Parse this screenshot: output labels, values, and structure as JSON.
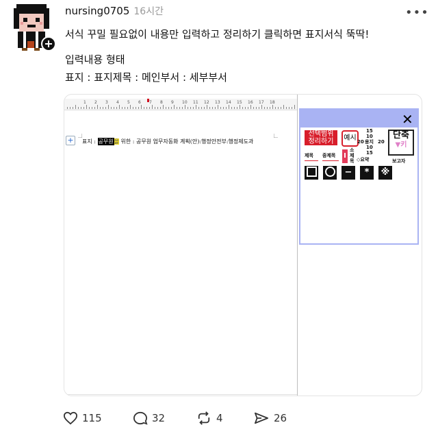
{
  "post": {
    "username": "nursing0705",
    "time": "16시간",
    "more_icon": "ellipsis-icon",
    "text_lines": [
      "서식 꾸밀 필요없이 내용만 입력하고 정리하기 클릭하면 표지서식 뚝딱!",
      "입력내용 형태",
      "표지 : 표지제목 : 메인부서 : 세부부서"
    ]
  },
  "document": {
    "line_prefix": "표지 : ",
    "selected_text": "공무원",
    "highlighted_text": "을",
    "line_rest": "위한 : 공무원 업무자동화 계획(안):행정안전부:행정제도과",
    "ruler_numbers": [
      "1",
      "2",
      "3",
      "4",
      "5",
      "6",
      "7",
      "8",
      "9",
      "10",
      "11",
      "12",
      "13",
      "14",
      "15",
      "16",
      "17",
      "18"
    ]
  },
  "panel": {
    "close_label": "✕",
    "organize_line1": "선택범위",
    "organize_line2": "정리하기",
    "example_label": "예시",
    "num_15a": "15",
    "num_10a": "10",
    "num_20a": "20",
    "num_yongji": "용지",
    "num_20b": "20",
    "num_10b": "10",
    "num_15b": "15",
    "shortcut_line1": "단축",
    "shortcut_line2": "▼키",
    "title_label": "제목",
    "mid_title_label": "중제목",
    "i_label": "I",
    "small_title_vertical": "소제목",
    "summary_label": "◇요약",
    "reporter_label": "보고자",
    "symbol_square": "□",
    "symbol_circle": "○",
    "symbol_dash": "−",
    "symbol_asterisk": "*",
    "symbol_ref": "※"
  },
  "actions": {
    "likes": "115",
    "comments": "32",
    "reposts": "4",
    "shares": "26"
  },
  "colors": {
    "panel_accent": "#a9b3f3",
    "red": "#d81e2b",
    "highlight_yellow": "#f3e02a"
  }
}
